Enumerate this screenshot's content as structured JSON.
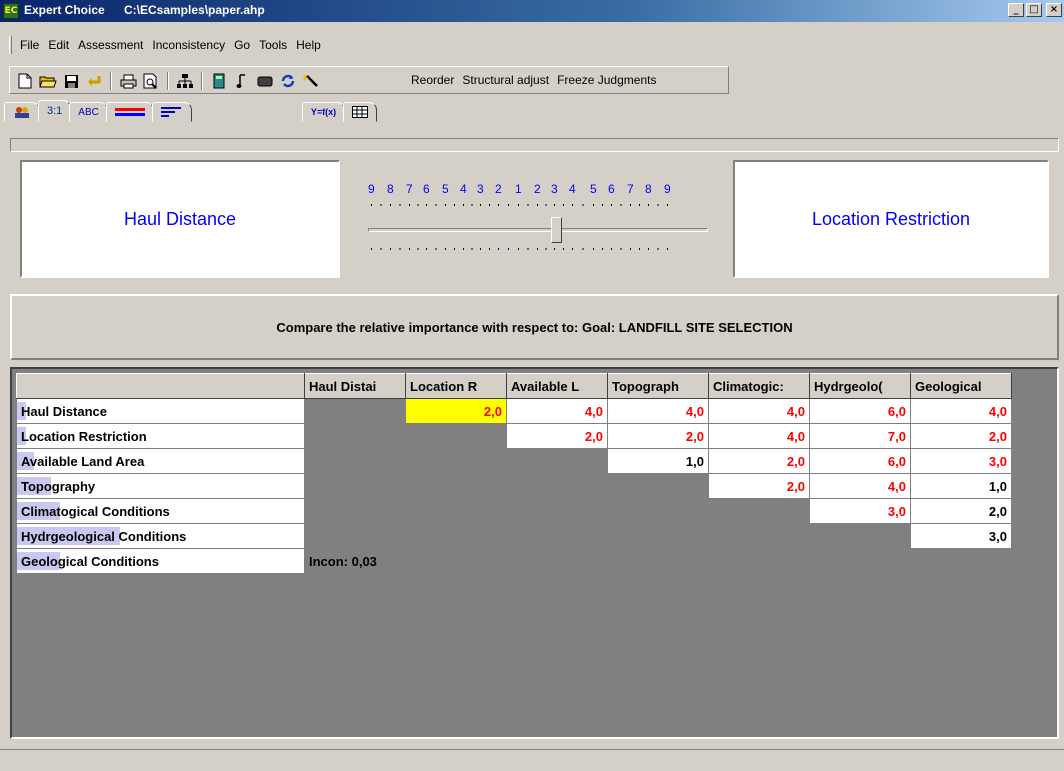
{
  "window": {
    "app_name": "Expert Choice",
    "file_path": "C:\\ECsamples\\paper.ahp",
    "app_icon_text": "EC",
    "controls": {
      "minimize": "_",
      "maximize": "□",
      "close": "×"
    }
  },
  "menu": [
    "File",
    "Edit",
    "Assessment",
    "Inconsistency",
    "Go",
    "Tools",
    "Help"
  ],
  "toolbar": {
    "icons": [
      "new-file-icon",
      "open-folder-icon",
      "save-disk-icon",
      "undo-arrow-icon",
      "print-icon",
      "print-preview-icon",
      "hierarchy-icon",
      "calculator-icon",
      "music-note-icon",
      "keyboard-icon",
      "refresh-icon",
      "magic-wand-icon"
    ],
    "text_buttons": [
      "Reorder",
      "Structural adjust",
      "Freeze Judgments"
    ]
  },
  "tabs": [
    {
      "label": "",
      "icon": "people-icon"
    },
    {
      "label": "3:1",
      "icon": ""
    },
    {
      "label": "ABC",
      "icon": ""
    },
    {
      "label": "",
      "icon": "bars-icon"
    },
    {
      "label": "",
      "icon": "sorted-bars-icon"
    },
    {
      "label": "Y=f(x)",
      "icon": ""
    },
    {
      "label": "",
      "icon": "grid-icon"
    }
  ],
  "comparison": {
    "left": "Haul Distance",
    "right": "Location Restriction",
    "scale_numbers": [
      "9",
      "8",
      "7",
      "6",
      "5",
      "4",
      "3",
      "2",
      "1",
      "2",
      "3",
      "4",
      "5",
      "6",
      "7",
      "8",
      "9"
    ],
    "slider_value": "2"
  },
  "instruction": "Compare the relative importance  with respect to: Goal: LANDFILL SITE SELECTION",
  "matrix": {
    "columns": [
      "Haul Distai",
      "Location R",
      "Available L",
      "Topograph",
      "Climatogic:",
      "Hydrgeolo(",
      "Geological"
    ],
    "rows": [
      {
        "label": "Haul Distance",
        "hl": 1,
        "cells": [
          "",
          "2,0",
          "4,0",
          "4,0",
          "4,0",
          "6,0",
          "4,0"
        ]
      },
      {
        "label": "Location Restriction",
        "hl": 1,
        "cells": [
          "",
          "",
          "2,0",
          "2,0",
          "4,0",
          "7,0",
          "2,0"
        ]
      },
      {
        "label": "Available Land Area",
        "hl": 2,
        "cells": [
          "",
          "",
          "",
          "1,0",
          "2,0",
          "6,0",
          "3,0"
        ]
      },
      {
        "label": "Topography",
        "hl": 4,
        "cells": [
          "",
          "",
          "",
          "",
          "2,0",
          "4,0",
          "1,0"
        ]
      },
      {
        "label": "Climatogical Conditions",
        "hl": 5,
        "cells": [
          "",
          "",
          "",
          "",
          "",
          "3,0",
          "2,0"
        ]
      },
      {
        "label": "Hydrgeological Conditions",
        "hl": 12,
        "cells": [
          "",
          "",
          "",
          "",
          "",
          "",
          "3,0"
        ]
      },
      {
        "label": "Geological Conditions",
        "hl": 5,
        "cells": [
          "Incon: 0,03",
          "",
          "",
          "",
          "",
          "",
          ""
        ]
      }
    ],
    "colors": {
      "red_value": "#ff0000",
      "selected_cell": "#ffff00",
      "disabled_cell": "#808080"
    }
  }
}
